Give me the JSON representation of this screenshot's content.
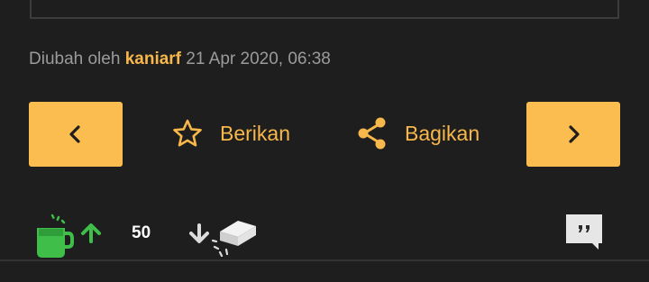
{
  "edit_info": {
    "prefix": "Diubah oleh",
    "author": "kaniarf",
    "timestamp": "21 Apr 2020, 06:38"
  },
  "actions": {
    "give_label": "Berikan",
    "share_label": "Bagikan"
  },
  "votes": {
    "count": "50"
  },
  "icons": {
    "prev": "chevron-left-icon",
    "next": "chevron-right-icon",
    "give": "star-outline-icon",
    "share": "share-icon",
    "upvote_cup": "hot-cup-icon",
    "upvote_arrow": "arrow-up-icon",
    "downvote_arrow": "arrow-down-icon",
    "downvote_brick": "brick-icon",
    "quote": "quote-bubble-icon"
  },
  "colors": {
    "background": "#1e1e1e",
    "accent": "#fbbd4f",
    "link": "#f8b74b",
    "muted_text": "#9b9b9b",
    "upvote_green": "#3fbf4a"
  }
}
